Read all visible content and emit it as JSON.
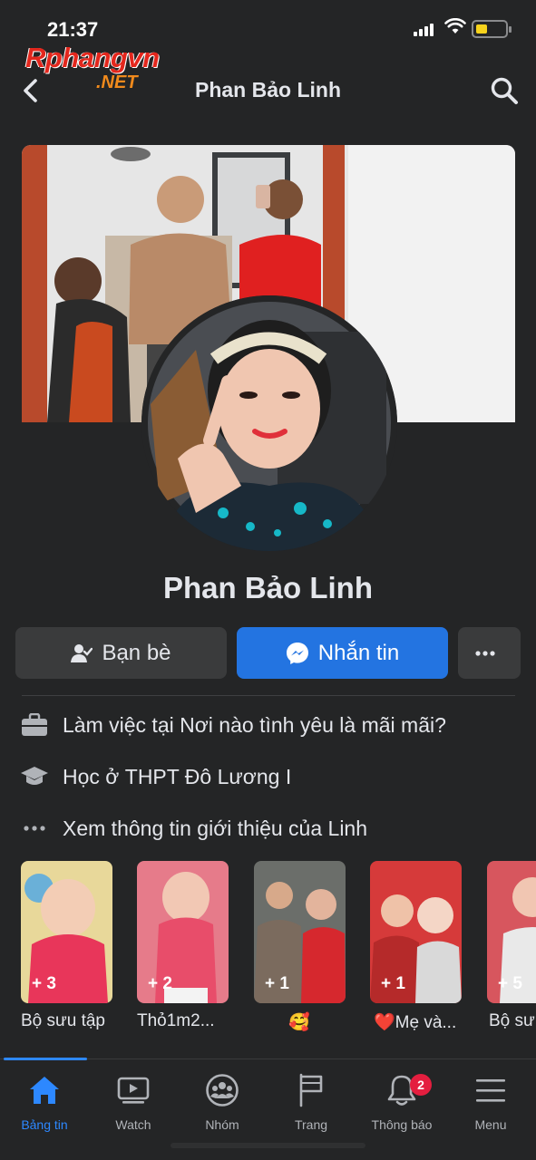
{
  "status_bar": {
    "time": "21:37"
  },
  "watermark": {
    "line1": "Rphangvn",
    "line2": ".NET"
  },
  "header": {
    "title": "Phan Bảo Linh"
  },
  "profile": {
    "name": "Phan Bảo Linh"
  },
  "actions": {
    "friends_label": "Bạn bè",
    "message_label": "Nhắn tin"
  },
  "intro": [
    {
      "prefix": "Làm việc tại ",
      "value": "Nơi nào tình yêu là mãi mãi?"
    },
    {
      "prefix": "Học ở ",
      "value": "THPT Đô Lương I"
    },
    {
      "prefix": "",
      "value": "Xem thông tin giới thiệu của Linh"
    }
  ],
  "highlights": [
    {
      "count": "+ 3",
      "caption": "Bộ sưu tập"
    },
    {
      "count": "+ 2",
      "caption": "Thỏ1m2..."
    },
    {
      "count": "+ 1",
      "caption": "🥰"
    },
    {
      "count": "+ 1",
      "caption": "❤️Mẹ và..."
    },
    {
      "count": "+ 5",
      "caption": "Bộ sư"
    }
  ],
  "tabbar": {
    "tabs": [
      {
        "label": "Bảng tin",
        "icon": "home-icon",
        "active": true
      },
      {
        "label": "Watch",
        "icon": "video-icon"
      },
      {
        "label": "Nhóm",
        "icon": "groups-icon"
      },
      {
        "label": "Trang",
        "icon": "flag-icon"
      },
      {
        "label": "Thông báo",
        "icon": "bell-icon",
        "badge": "2"
      },
      {
        "label": "Menu",
        "icon": "menu-icon"
      }
    ]
  },
  "colors": {
    "background": "#242526",
    "accent": "#2374e1",
    "tab_active": "#2d88ff",
    "badge": "#e41e3f"
  }
}
